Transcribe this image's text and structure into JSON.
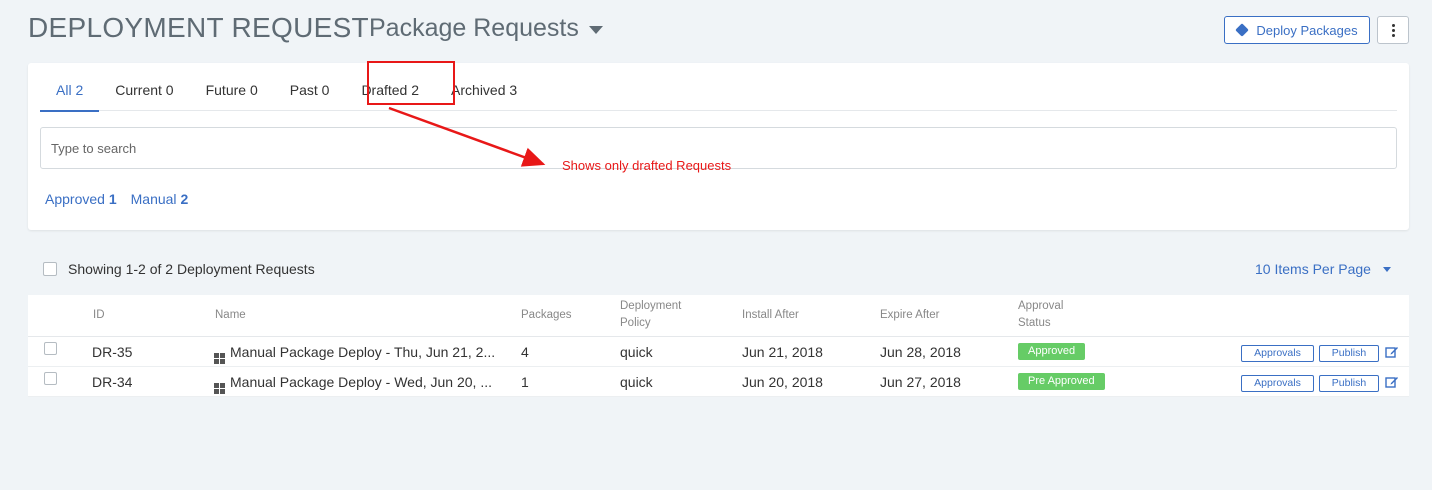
{
  "header": {
    "title": "DEPLOYMENT REQUEST",
    "subtitle": "Package Requests",
    "deploy_button": "Deploy Packages"
  },
  "tabs": [
    {
      "label": "All 2",
      "active": true
    },
    {
      "label": "Current 0",
      "active": false
    },
    {
      "label": "Future 0",
      "active": false
    },
    {
      "label": "Past 0",
      "active": false
    },
    {
      "label": "Drafted 2",
      "active": false
    },
    {
      "label": "Archived 3",
      "active": false
    }
  ],
  "search": {
    "placeholder": "Type to search"
  },
  "filters": [
    {
      "label": "Approved",
      "count": "1"
    },
    {
      "label": "Manual",
      "count": "2"
    }
  ],
  "annotation": "Shows only drafted Requests",
  "list": {
    "showing": "Showing 1-2 of 2 Deployment Requests",
    "per_page": "10 Items Per Page"
  },
  "table": {
    "columns": {
      "id": "ID",
      "name": "Name",
      "packages": "Packages",
      "policy_line1": "Deployment",
      "policy_line2": "Policy",
      "install_after": "Install After",
      "expire_after": "Expire After",
      "status_line1": "Approval",
      "status_line2": "Status"
    },
    "rows": [
      {
        "id": "DR-35",
        "name": "Manual Package Deploy - Thu, Jun 21, 2...",
        "packages": "4",
        "policy": "quick",
        "install_after": "Jun 21, 2018",
        "expire_after": "Jun 28, 2018",
        "status": "Approved",
        "approvals": "Approvals",
        "publish": "Publish"
      },
      {
        "id": "DR-34",
        "name": "Manual Package Deploy - Wed, Jun 20, ...",
        "packages": "1",
        "policy": "quick",
        "install_after": "Jun 20, 2018",
        "expire_after": "Jun 27, 2018",
        "status": "Pre Approved",
        "approvals": "Approvals",
        "publish": "Publish"
      }
    ]
  },
  "colors": {
    "accent": "#3a6fc4",
    "status_green": "#66cc66",
    "annotation_red": "#e81818"
  }
}
